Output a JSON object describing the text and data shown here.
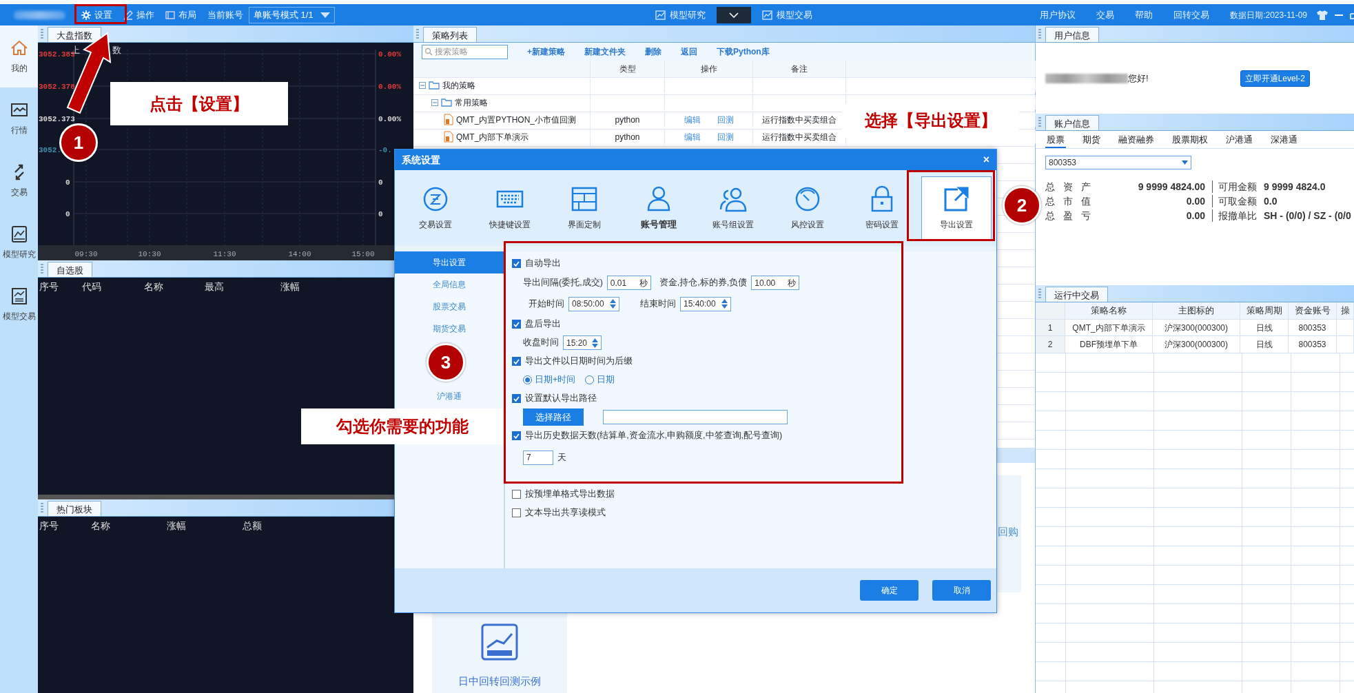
{
  "top_bar": {
    "menu": [
      {
        "label": "设置"
      },
      {
        "label": "操作"
      },
      {
        "label": "布局"
      }
    ],
    "account_label": "当前账号",
    "account_mode": "单账号模式 1/1",
    "center_tabs": [
      {
        "label": "模型研究"
      },
      {
        "label": "模型交易"
      }
    ],
    "right_menu": [
      "用户协议",
      "交易",
      "帮助",
      "回转交易"
    ],
    "data_date": "数据日期:2023-11-09"
  },
  "sidebar": {
    "items": [
      {
        "label": "我的",
        "selected": true
      },
      {
        "label": "行情",
        "selected": false
      },
      {
        "label": "交易",
        "selected": false
      },
      {
        "label": "模型研究",
        "selected": false
      },
      {
        "label": "模型交易",
        "selected": false
      }
    ]
  },
  "index_panel": {
    "tab": "大盘指数",
    "chart_title": [
      "上",
      "数"
    ],
    "left_labels": [
      {
        "text": "3052.383",
        "color": "#e03a3a"
      },
      {
        "text": "3052.378",
        "color": "#e03a3a"
      },
      {
        "text": "3052.373",
        "color": "#d8d8d8"
      },
      {
        "text": "3052.",
        "color": "#3f8fa8"
      },
      {
        "text": "0",
        "color": "#d8d8d8"
      },
      {
        "text": "0",
        "color": "#d8d8d8"
      }
    ],
    "right_labels": [
      {
        "text": "0.00%",
        "color": "#e03a3a"
      },
      {
        "text": "0.00%",
        "color": "#e03a3a"
      },
      {
        "text": "0.00%",
        "color": "#d8d8d8"
      },
      {
        "text": "-0.",
        "color": "#3f8fa8"
      },
      {
        "text": "0",
        "color": "#d8d8d8"
      },
      {
        "text": "0",
        "color": "#d8d8d8"
      }
    ],
    "time_labels": [
      "09:30",
      "10:30",
      "11:30",
      "14:00",
      "15:00"
    ]
  },
  "watchlist": {
    "tab": "自选股",
    "columns": [
      "序号",
      "代码",
      "名称",
      "最高",
      "涨幅"
    ]
  },
  "hot_sectors": {
    "tab": "热门板块",
    "columns": [
      "序号",
      "名称",
      "涨幅",
      "总额"
    ]
  },
  "strategy_panel": {
    "tab": "策略列表",
    "search": {
      "placeholder": "搜索策略"
    },
    "actions": [
      "+新建策略",
      "新建文件夹",
      "删除",
      "返回",
      "下载Python库"
    ],
    "columns": [
      "类型",
      "操作",
      "备注"
    ],
    "tree": [
      {
        "label": "我的策略",
        "expanded": true,
        "children": [
          {
            "label": "常用策略",
            "expanded": true,
            "children": [
              {
                "label": "QMT_内置PYTHON_小市值回测",
                "type": "python",
                "actions": [
                  "编辑",
                  "回测"
                ],
                "note": "运行指数中买卖组合"
              },
              {
                "label": "QMT_内部下单演示",
                "type": "python",
                "actions": [
                  "编辑",
                  "回测"
                ],
                "note": "运行指数中买卖组合"
              }
            ]
          }
        ]
      }
    ],
    "cards": [
      {
        "label": "日中回转回测示例"
      },
      {
        "label": "回购"
      }
    ]
  },
  "user_info": {
    "tab": "用户信息",
    "greeting": "您好!",
    "upgrade_button": "立即开通Level-2"
  },
  "account_info": {
    "tab": "账户信息",
    "tabs": [
      {
        "label": "股票",
        "selected": true
      },
      {
        "label": "期货",
        "selected": false
      },
      {
        "label": "融资融券",
        "selected": false
      },
      {
        "label": "股票期权",
        "selected": false
      },
      {
        "label": "沪港通",
        "selected": false
      },
      {
        "label": "深港通",
        "selected": false
      }
    ],
    "account": "800353",
    "stats": [
      {
        "label": "总 资 产",
        "value": "9 9999 4824.00",
        "label2": "可用金额",
        "value2": "9 9999 4824.0"
      },
      {
        "label": "总 市 值",
        "value": "0.00",
        "label2": "可取金额",
        "value2": "0.0"
      },
      {
        "label": "总 盈 亏",
        "value": "0.00",
        "label2": "报撤单比",
        "value2": "SH - (0/0) / SZ - (0/0"
      }
    ]
  },
  "running_trades": {
    "tab": "运行中交易",
    "columns": [
      "",
      "策略名称",
      "主图标的",
      "策略周期",
      "资金账号",
      "操"
    ],
    "rows": [
      [
        "1",
        "QMT_内部下单演示",
        "沪深300(000300)",
        "日线",
        "800353"
      ],
      [
        "2",
        "DBF预埋单下单",
        "沪深300(000300)",
        "日线",
        "800353"
      ]
    ]
  },
  "dialog": {
    "title": "系统设置",
    "close": "×",
    "categories": [
      {
        "label": "交易设置",
        "selected": false,
        "hovered": false
      },
      {
        "label": "快捷键设置",
        "selected": false,
        "hovered": false
      },
      {
        "label": "界面定制",
        "selected": false,
        "hovered": false
      },
      {
        "label": "账号管理",
        "selected": false,
        "hovered": true
      },
      {
        "label": "账号组设置",
        "selected": false,
        "hovered": false
      },
      {
        "label": "风控设置",
        "selected": false,
        "hovered": false
      },
      {
        "label": "密码设置",
        "selected": false,
        "hovered": false
      },
      {
        "label": "导出设置",
        "selected": true,
        "hovered": false
      }
    ],
    "nav": [
      {
        "label": "导出设置",
        "selected": true
      },
      {
        "label": "全局信息",
        "selected": false
      },
      {
        "label": "股票交易",
        "selected": false
      },
      {
        "label": "期货交易",
        "selected": false
      },
      {
        "label": "沪港通",
        "selected": false
      }
    ],
    "options": [
      {
        "kind": "checkbox",
        "label": "自动导出",
        "checked": true
      },
      {
        "kind": "interval",
        "label": "导出间隔(委托,成交)",
        "value": "0.01",
        "unit": "秒",
        "label2": "资金,持仓,标的券,负债",
        "value2": "10.00",
        "unit2": "秒"
      },
      {
        "kind": "time_range",
        "label": "开始时间",
        "value": "08:50:00",
        "label2": "结束时间",
        "value2": "15:40:00"
      },
      {
        "kind": "checkbox",
        "label": "盘后导出",
        "checked": true
      },
      {
        "kind": "time",
        "label": "收盘时间",
        "value": "15:20"
      },
      {
        "kind": "checkbox",
        "label": "导出文件以日期时间为后缀",
        "checked": true
      },
      {
        "kind": "radio",
        "options": [
          {
            "label": "日期+时间",
            "selected": true
          },
          {
            "label": "日期",
            "selected": false
          }
        ]
      },
      {
        "kind": "checkbox",
        "label": "设置默认导出路径",
        "checked": true
      },
      {
        "kind": "path",
        "button": "选择路径"
      },
      {
        "kind": "checkbox",
        "label": "导出历史数据天数(结算单,资金流水,申购额度,中签查询,配号查询)",
        "checked": true
      },
      {
        "kind": "days",
        "value": "7",
        "unit": "天"
      },
      {
        "kind": "checkbox",
        "label": "按预埋单格式导出数据",
        "checked": false
      },
      {
        "kind": "checkbox",
        "label": "文本导出共享读模式",
        "checked": false
      }
    ],
    "buttons": [
      "确定",
      "取消"
    ]
  },
  "annotations": {
    "steps": [
      "1",
      "2",
      "3"
    ],
    "callouts": [
      "点击【设置】",
      "选择【导出设置】",
      "勾选你需要的功能"
    ]
  }
}
